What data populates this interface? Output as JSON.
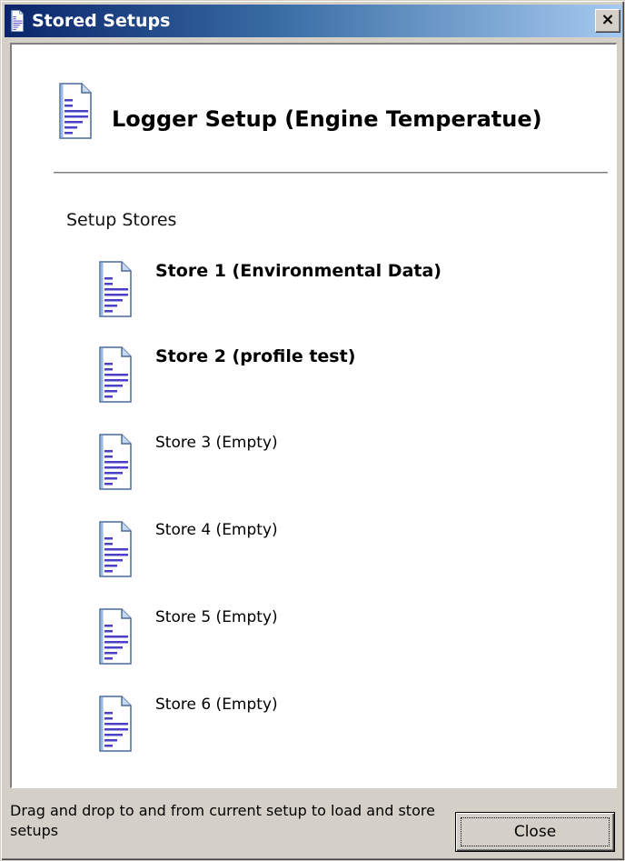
{
  "window": {
    "title": "Stored Setups",
    "close_glyph": "×",
    "title_icon": "document-icon"
  },
  "header": {
    "title": "Logger Setup (Engine Temperatue)",
    "icon": "document-icon"
  },
  "section": {
    "label": "Setup Stores"
  },
  "stores": [
    {
      "label": "Store 1 (Environmental Data)",
      "icon": "document-icon"
    },
    {
      "label": "Store 2 (profile test)",
      "icon": "document-icon"
    },
    {
      "label": "Store 3 (Empty)",
      "icon": "document-icon"
    },
    {
      "label": "Store 4 (Empty)",
      "icon": "document-icon"
    },
    {
      "label": "Store 5 (Empty)",
      "icon": "document-icon"
    },
    {
      "label": "Store 6 (Empty)",
      "icon": "document-icon"
    }
  ],
  "footer": {
    "status_text": "Drag and drop to and from current setup to load and store setups",
    "close_label": "Close"
  },
  "colors": {
    "title_bar_start": "#0a246a",
    "title_bar_end": "#a6caf0",
    "window_face": "#d4d0c8",
    "icon_lines": "#4b3fc8"
  }
}
